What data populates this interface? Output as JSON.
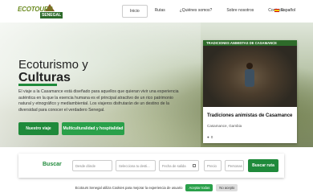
{
  "logo": {
    "text": "ECOTOURS",
    "badge": "SENEGAL"
  },
  "nav": {
    "items": [
      "Inicio",
      "Rutas",
      "¿Quiénes somos?",
      "Sobre nosotros",
      "Contacto"
    ],
    "lang": "Español"
  },
  "hero": {
    "title1": "Ecoturismo y",
    "title2": "Culturas",
    "desc": "El viaje a la Casamance está diseñado para aquellos que quieran vivir una experiencia auténtica en la que la esencia humana es el principal atractivo de un rico patrimonio natural y etnográfico y mediambiental. Los viajeros disfrutarán de un destino de la diversidad para conocer el verdadero Senegal."
  },
  "buttons": {
    "primary": "Nuestro viaje",
    "secondary": "Multiculturalidad y hospitalidad"
  },
  "card": {
    "badge": "TRADICIONES ANIMISTAS DE CASAMANCE",
    "title": "Tradiciones animistas de Casamance",
    "location": "Casamance, Gambia",
    "count": "0"
  },
  "search": {
    "title": "Buscar",
    "origin_placeholder": "Desde dónde",
    "destination_placeholder": "Selecciona tu desti...",
    "date_placeholder": "Fecha de salida",
    "price_placeholder": "Precio",
    "people_placeholder": "Personas",
    "button": "Buscar ruta"
  },
  "cookie": {
    "text": "Ecotours Senegal utiliza Cookies para mejorar la experiencia de usuario",
    "accept": "Aceptar todas",
    "reject": "No acepto"
  }
}
